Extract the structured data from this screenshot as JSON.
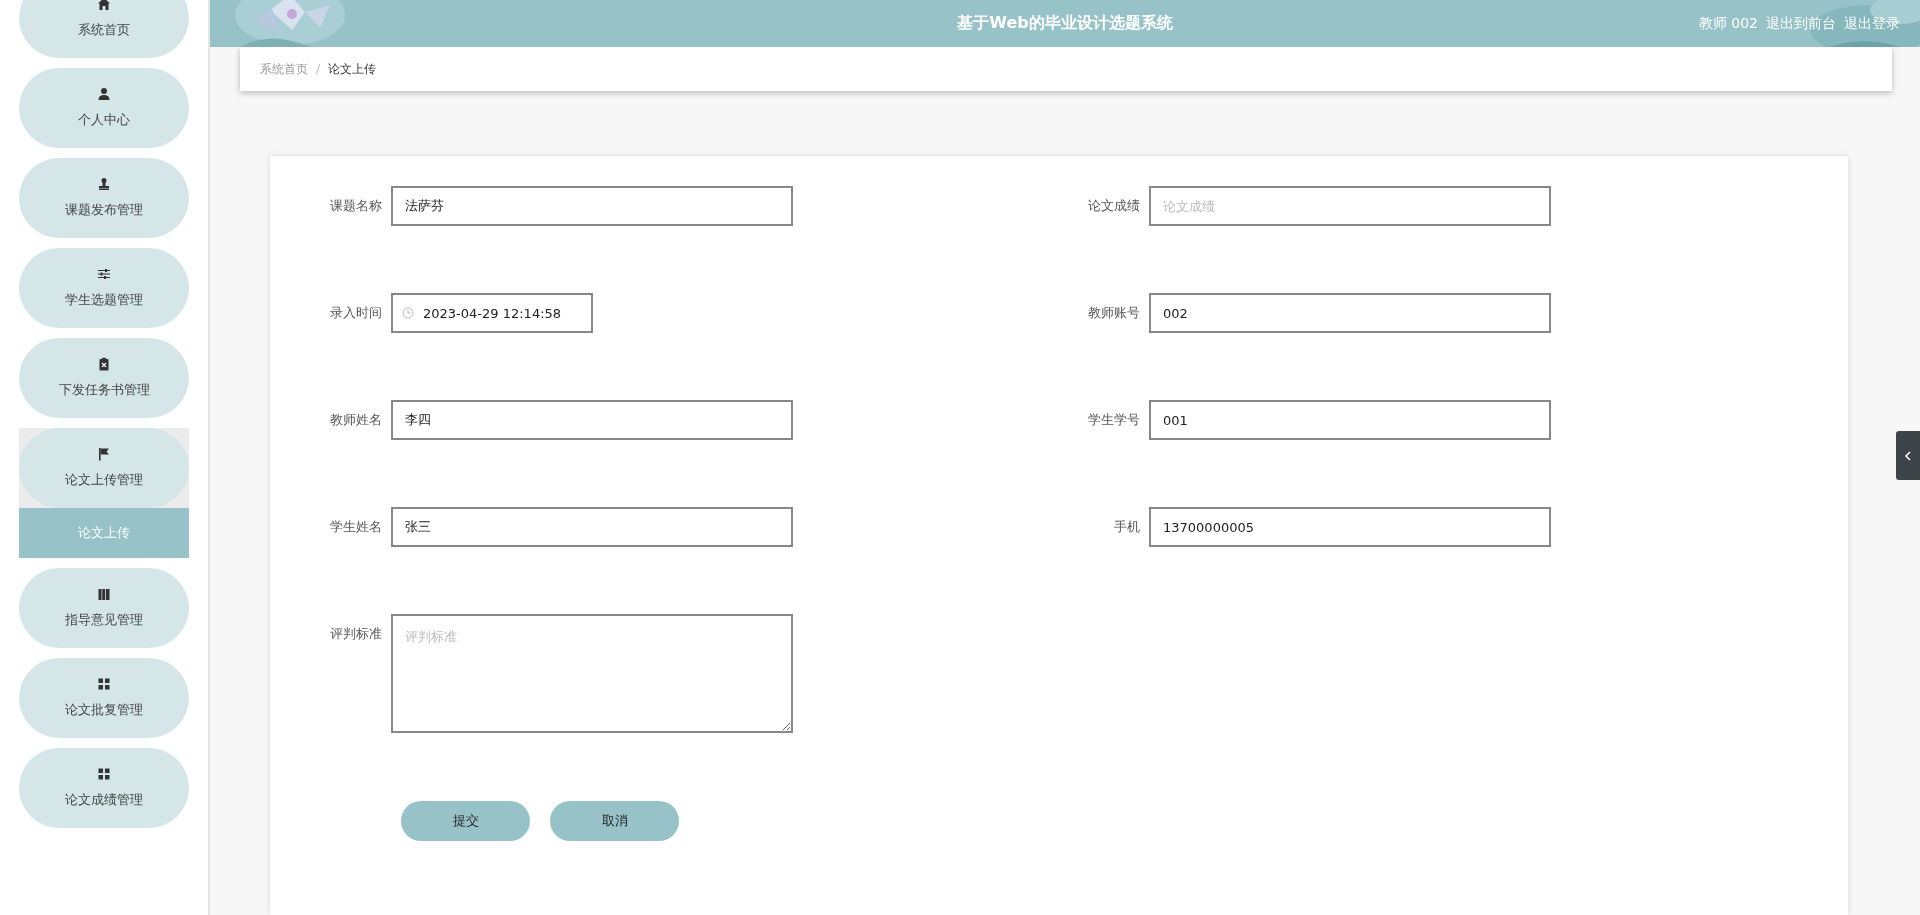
{
  "sidebar": {
    "items": [
      {
        "label": "系统首页",
        "expanded": false
      },
      {
        "label": "个人中心",
        "expanded": false
      },
      {
        "label": "课题发布管理",
        "expanded": false
      },
      {
        "label": "学生选题管理",
        "expanded": false
      },
      {
        "label": "下发任务书管理",
        "expanded": false
      },
      {
        "label": "论文上传管理",
        "expanded": true,
        "children": [
          {
            "label": "论文上传",
            "selected": true
          }
        ]
      },
      {
        "label": "指导意见管理",
        "expanded": false
      },
      {
        "label": "论文批复管理",
        "expanded": false
      },
      {
        "label": "论文成绩管理",
        "expanded": false
      }
    ]
  },
  "header": {
    "title": "基于Web的毕业设计选题系统",
    "user": "教师 002",
    "links": [
      "退出到前台",
      "退出登录"
    ]
  },
  "breadcrumb_separator": "/",
  "breadcrumb": [
    {
      "label": "系统首页",
      "selected": false
    },
    {
      "label": "论文上传",
      "selected": true
    }
  ],
  "form": {
    "fields": [
      {
        "label": "课题名称",
        "kind": "text",
        "value": "法萨芬"
      },
      {
        "label": "论文成绩",
        "kind": "text",
        "placeholder": "论文成绩"
      },
      {
        "label": "录入时间",
        "kind": "date",
        "value": "2023-04-29 12:14:58"
      },
      {
        "label": "教师账号",
        "kind": "text",
        "value": "002"
      },
      {
        "label": "教师姓名",
        "kind": "text",
        "value": "李四"
      },
      {
        "label": "学生学号",
        "kind": "text",
        "value": "001"
      },
      {
        "label": "学生姓名",
        "kind": "text",
        "value": "张三"
      },
      {
        "label": "手机",
        "kind": "text",
        "value": "13700000005"
      },
      {
        "label": "评判标准",
        "kind": "textarea",
        "placeholder": "评判标准"
      }
    ],
    "buttons": [
      "提交",
      "取消"
    ]
  }
}
